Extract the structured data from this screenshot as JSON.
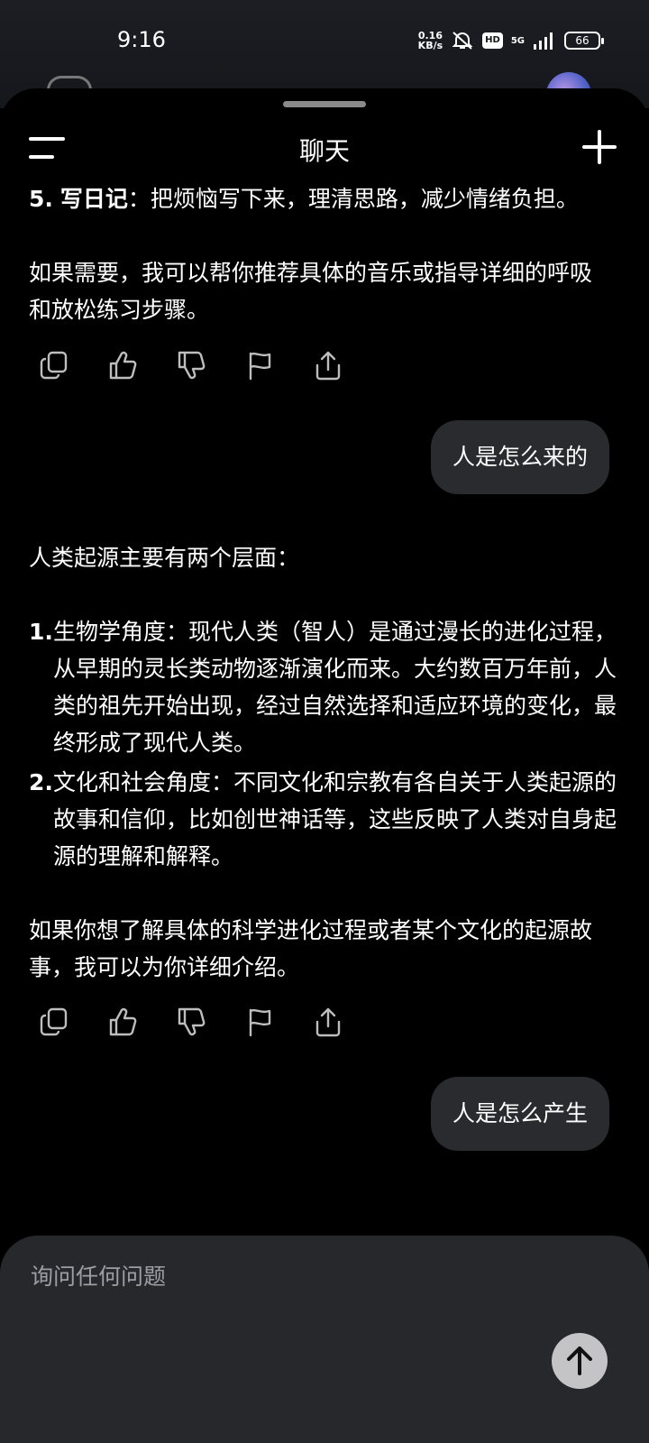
{
  "status_bar": {
    "time": "9:16",
    "net_speed_value": "0.16",
    "net_speed_unit": "KB/s",
    "hd_label": "HD",
    "network": "5G",
    "battery": "66"
  },
  "header": {
    "title": "聊天"
  },
  "messages": {
    "a1_item5_num": "5.",
    "a1_item5_bold": "写日记",
    "a1_item5_rest": "：把烦恼写下来，理清思路，减少情绪负担。",
    "a1_outro": "如果需要，我可以帮你推荐具体的音乐或指导详细的呼吸和放松练习步骤。",
    "u1": "人是怎么来的",
    "a2_intro": "人类起源主要有两个层面：",
    "a2_item1_num": "1.",
    "a2_item1_text": "生物学角度：现代人类（智人）是通过漫长的进化过程，从早期的灵长类动物逐渐演化而来。大约数百万年前，人类的祖先开始出现，经过自然选择和适应环境的变化，最终形成了现代人类。",
    "a2_item2_num": "2.",
    "a2_item2_text": "文化和社会角度：不同文化和宗教有各自关于人类起源的故事和信仰，比如创世神话等，这些反映了人类对自身起源的理解和解释。",
    "a2_outro": "如果你想了解具体的科学进化过程或者某个文化的起源故事，我可以为你详细介绍。",
    "u2": "人是怎么产生"
  },
  "composer": {
    "placeholder": "询问任何问题"
  },
  "icons": {
    "copy": "copy-icon",
    "like": "thumbs-up-icon",
    "dislike": "thumbs-down-icon",
    "report": "flag-icon",
    "share": "share-icon",
    "send": "arrow-up-icon"
  },
  "colors": {
    "background": "#000000",
    "bubble": "#2a2b2f",
    "composer": "#27282c",
    "send_button": "#c4c4c6"
  }
}
